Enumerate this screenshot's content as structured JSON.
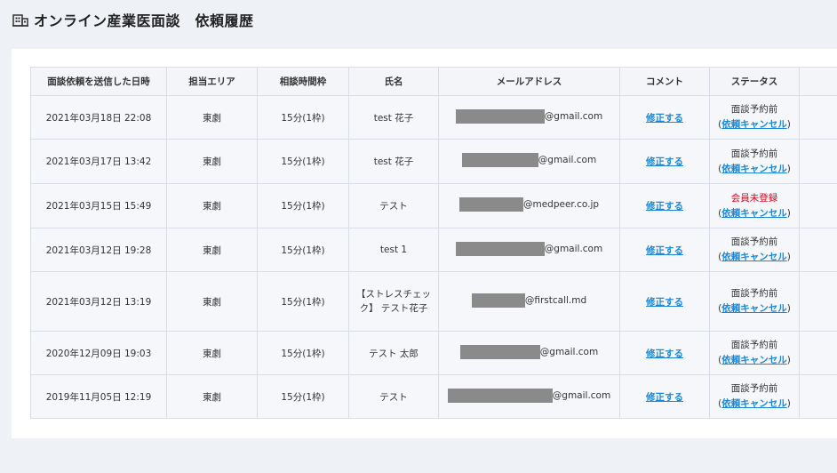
{
  "page": {
    "title": "オンライン産業医面談　依頼履歴",
    "icon": "building-icon"
  },
  "table": {
    "headers": [
      "面談依頼を送信した日時",
      "担当エリア",
      "相談時間枠",
      "氏名",
      "メールアドレス",
      "コメント",
      "ステータス",
      ""
    ],
    "rows": [
      {
        "datetime": "2021年03月18日 22:08",
        "area": "東劇",
        "slot": "15分(1枠)",
        "name": "test 花子",
        "email_suffix": "@gmail.com",
        "comment": "修正する",
        "status": "面談予約前",
        "cancel": "依頼キャンセル"
      },
      {
        "datetime": "2021年03月17日 13:42",
        "area": "東劇",
        "slot": "15分(1枠)",
        "name": "test 花子",
        "email_suffix": "@gmail.com",
        "comment": "修正する",
        "status": "面談予約前",
        "cancel": "依頼キャンセル"
      },
      {
        "datetime": "2021年03月15日 15:49",
        "area": "東劇",
        "slot": "15分(1枠)",
        "name": "テスト",
        "email_suffix": "@medpeer.co.jp",
        "comment": "修正する",
        "status": "会員未登録",
        "cancel": "依頼キャンセル"
      },
      {
        "datetime": "2021年03月12日 19:28",
        "area": "東劇",
        "slot": "15分(1枠)",
        "name": "test 1",
        "email_suffix": "@gmail.com",
        "comment": "修正する",
        "status": "面談予約前",
        "cancel": "依頼キャンセル"
      },
      {
        "datetime": "2021年03月12日 13:19",
        "area": "東劇",
        "slot": "15分(1枠)",
        "name": "【ストレスチェック】 テスト花子",
        "email_suffix": "@firstcall.md",
        "comment": "修正する",
        "status": "面談予約前",
        "cancel": "依頼キャンセル"
      },
      {
        "datetime": "2020年12月09日 19:03",
        "area": "東劇",
        "slot": "15分(1枠)",
        "name": "テスト 太郎",
        "email_suffix": "@gmail.com",
        "comment": "修正する",
        "status": "面談予約前",
        "cancel": "依頼キャンセル"
      },
      {
        "datetime": "2019年11月05日 12:19",
        "area": "東劇",
        "slot": "15分(1枠)",
        "name": "テスト",
        "email_suffix": "@gmail.com",
        "comment": "修正する",
        "status": "面談予約前",
        "cancel": "依頼キャンセル"
      }
    ]
  },
  "colors": {
    "link": "#1e88d6",
    "warning": "#e0001b",
    "background": "#eef1f5"
  }
}
